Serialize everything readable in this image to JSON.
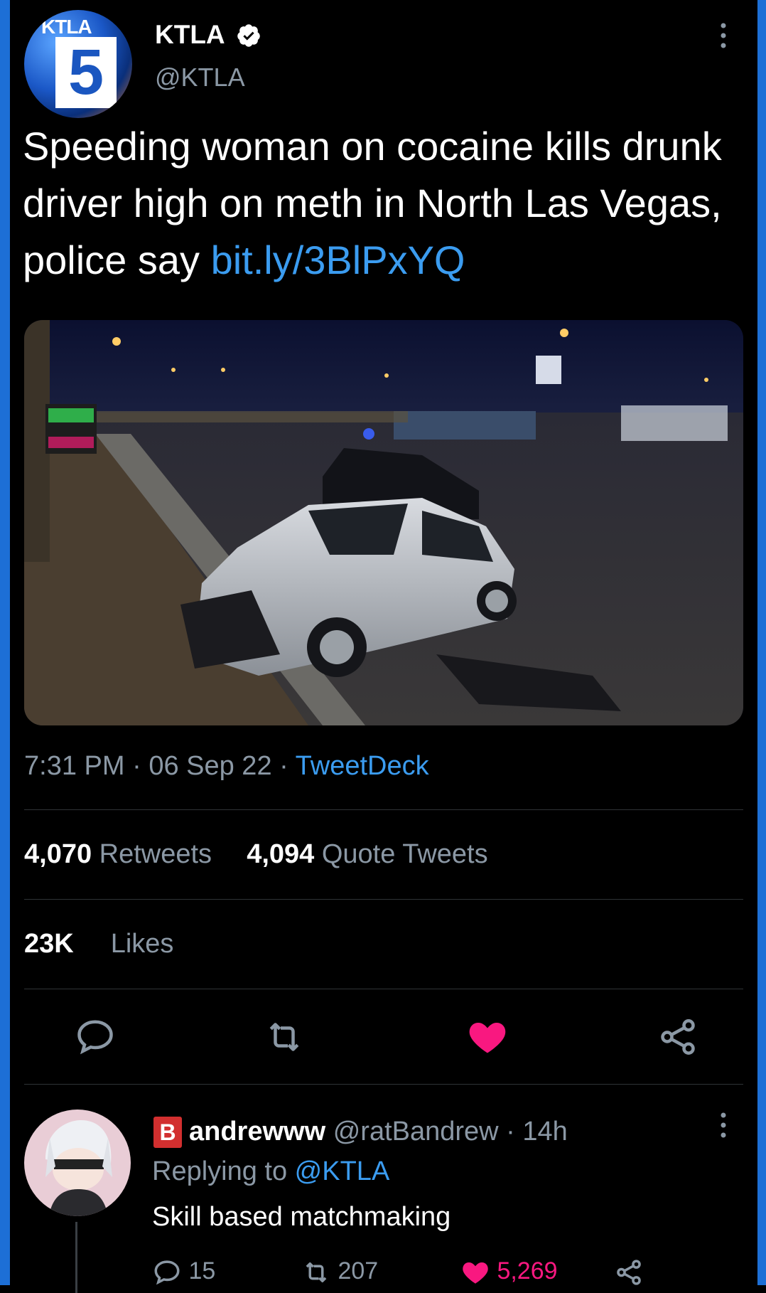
{
  "tweet": {
    "author": {
      "display_name": "KTLA",
      "handle": "@KTLA",
      "verified": true,
      "avatar_text": "KTLA",
      "avatar_number": "5"
    },
    "text_main": "Speeding woman on cocaine kills drunk driver high on meth in North Las Vegas, police say ",
    "text_link": "bit.ly/3BlPxYQ",
    "time": "7:31 PM",
    "sep1": " · ",
    "date": "06 Sep 22",
    "sep2": " · ",
    "client": "TweetDeck",
    "retweets_count": "4,070",
    "retweets_label": "Retweets",
    "quotes_count": "4,094",
    "quotes_label": "Quote Tweets",
    "likes_count": "23K",
    "likes_label": "Likes",
    "liked": true
  },
  "reply": {
    "badge": "B",
    "display_name": "andrewww",
    "handle": "@ratBandrew",
    "time_sep": " · ",
    "time": "14h",
    "replying_prefix": "Replying to ",
    "replying_to": "@KTLA",
    "text": "Skill based matchmaking",
    "reply_count": "15",
    "retweet_count": "207",
    "like_count": "5,269"
  },
  "colors": {
    "background": "#000000",
    "link": "#3b9cf0",
    "muted": "#8b98a5",
    "like": "#f91880",
    "edge": "#1d6fd6"
  },
  "icons": [
    "verified-badge-icon",
    "more-icon",
    "reply-icon",
    "retweet-icon",
    "heart-icon",
    "share-icon"
  ]
}
